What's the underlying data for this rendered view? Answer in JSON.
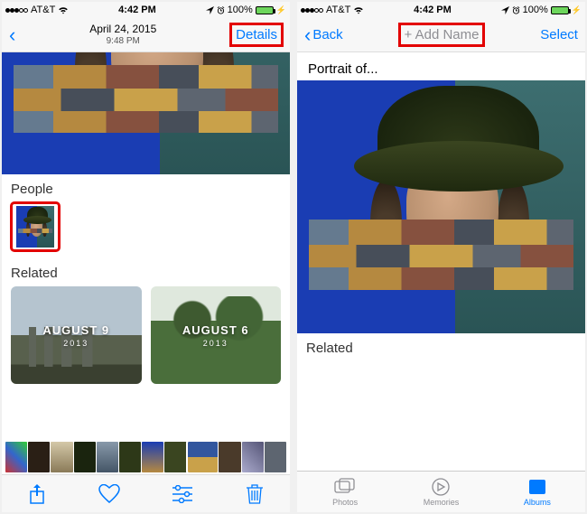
{
  "status": {
    "carrier": "AT&T",
    "time": "4:42 PM",
    "battery_pct": "100%"
  },
  "left": {
    "nav": {
      "title": "April 24, 2015",
      "subtitle": "9:48 PM",
      "details": "Details"
    },
    "sections": {
      "people": "People",
      "related": "Related"
    },
    "related": [
      {
        "month": "AUGUST 9",
        "year": "2013"
      },
      {
        "month": "AUGUST 6",
        "year": "2013"
      }
    ]
  },
  "right": {
    "nav": {
      "back": "Back",
      "add_name": "+ Add Name",
      "select": "Select"
    },
    "subtitle": "Portrait of...",
    "sections": {
      "related": "Related"
    },
    "tabs": {
      "photos": "Photos",
      "memories": "Memories",
      "albums": "Albums"
    }
  }
}
